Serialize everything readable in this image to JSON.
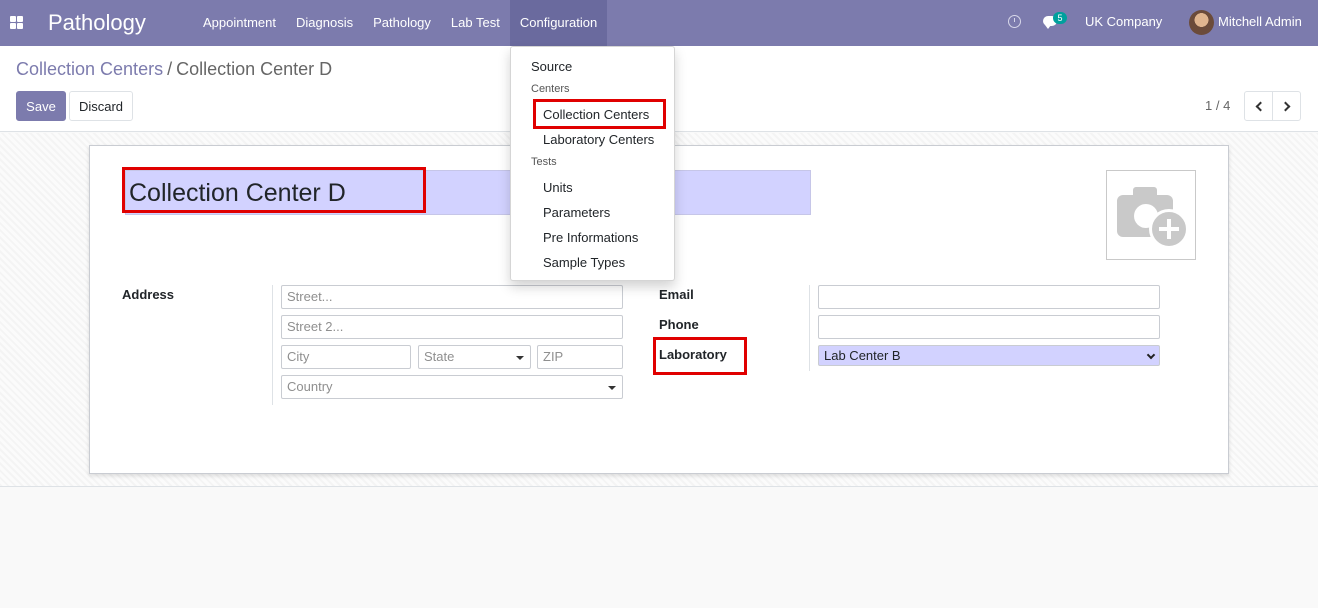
{
  "navbar": {
    "brand": "Pathology",
    "menu": [
      "Appointment",
      "Diagnosis",
      "Pathology",
      "Lab Test",
      "Configuration"
    ],
    "chat_count": "5",
    "company": "UK Company",
    "user": "Mitchell Admin",
    "color": "#7c7bad"
  },
  "breadcrumb": {
    "parent": "Collection Centers",
    "separator": "/",
    "current": "Collection Center D"
  },
  "buttons": {
    "save": "Save",
    "discard": "Discard"
  },
  "pager": {
    "value": "1 / 4"
  },
  "dropdown": {
    "items": [
      {
        "label": "Source"
      },
      {
        "header": "Centers"
      },
      {
        "label": "Collection Centers"
      },
      {
        "label": "Laboratory Centers"
      },
      {
        "header": "Tests"
      },
      {
        "label": "Units"
      },
      {
        "label": "Parameters"
      },
      {
        "label": "Pre Informations"
      },
      {
        "label": "Sample Types"
      }
    ]
  },
  "form": {
    "name": "Collection Center D",
    "address_label": "Address",
    "street_placeholder": "Street...",
    "street2_placeholder": "Street 2...",
    "city_placeholder": "City",
    "state_placeholder": "State",
    "zip_placeholder": "ZIP",
    "country_placeholder": "Country",
    "email_label": "Email",
    "phone_label": "Phone",
    "laboratory_label": "Laboratory",
    "laboratory_value": "Lab Center B"
  },
  "colors": {
    "highlight": "#e00000",
    "required_field": "#d2d2ff"
  }
}
